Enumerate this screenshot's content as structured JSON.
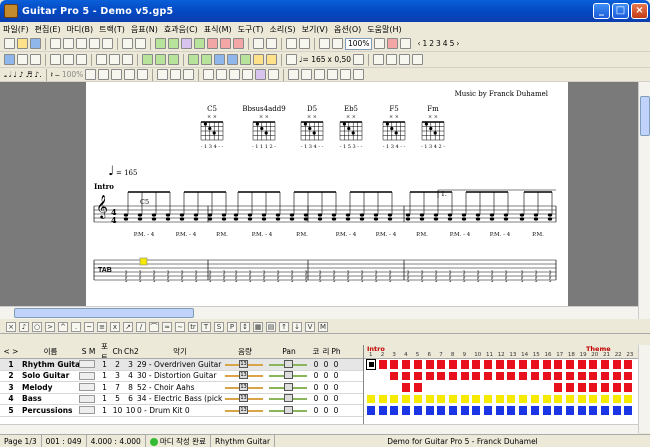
{
  "window": {
    "title": "Guitar Pro 5 - Demo v5.gp5"
  },
  "menu": [
    "파일(F)",
    "편집(E)",
    "마디(B)",
    "트랙(T)",
    "음표(N)",
    "효과음(C)",
    "표식(M)",
    "도구(T)",
    "소리(S)",
    "보기(V)",
    "옵션(O)",
    "도움말(H)"
  ],
  "toolbar": {
    "zoom": "100%",
    "pages": [
      "1",
      "2",
      "3",
      "4",
      "5"
    ],
    "tempo": "♩= 165",
    "speed": "x 0,50",
    "zoom_label": "100%"
  },
  "score": {
    "credit": "Music by Franck Duhamel",
    "chords": [
      {
        "name": "C5",
        "fingering": "- 1 3 4 - -"
      },
      {
        "name": "Bbsus4add9",
        "fingering": "- 1 1 1 2 -"
      },
      {
        "name": "D5",
        "fingering": "- 1 3 4 - -"
      },
      {
        "name": "Eb5",
        "fingering": "- 1 5 3 - -"
      },
      {
        "name": "F5",
        "fingering": "- 1 3 4 - -"
      },
      {
        "name": "Fm",
        "fingering": "- 1 3 4 2 -"
      }
    ],
    "tempo": "= 165",
    "section": "Intro",
    "chord_above": "C5",
    "volta": "1.",
    "pm_labels": [
      "P.M. - 4",
      "P.M. - 4",
      "P.M.",
      "P.M. - 4",
      "P.M.",
      "P.M. - 4",
      "P.M. - 4",
      "P.M.",
      "P.M. - 4",
      "P.M. - 4",
      "P.M."
    ],
    "tab_label": "TAB",
    "time_sig": [
      "4",
      "4"
    ]
  },
  "tracks": {
    "header": {
      "num": "< >",
      "name": "이름",
      "sm": "S M",
      "port": "포트",
      "ch": "Ch",
      "ch2": "Ch2",
      "instrument": "악기",
      "volume": "음량",
      "pan": "Pan",
      "c1": "코",
      "c2": "리",
      "ph": "Ph"
    },
    "rows": [
      {
        "num": "1",
        "name": "Rhythm Guitar",
        "port": "1",
        "ch": "2",
        "ch2": "3",
        "instrument": "29 - Overdriven Guitar",
        "vol": "13",
        "pan": "8",
        "c": "0",
        "r": "0",
        "ph": "0"
      },
      {
        "num": "2",
        "name": "Solo Guitar",
        "port": "1",
        "ch": "3",
        "ch2": "4",
        "instrument": "30 - Distortion Guitar",
        "vol": "13",
        "pan": "8",
        "c": "0",
        "r": "0",
        "ph": "0"
      },
      {
        "num": "3",
        "name": "Melody",
        "port": "1",
        "ch": "7",
        "ch2": "8",
        "instrument": "52 - Choir Aahs",
        "vol": "13",
        "pan": "8",
        "c": "0",
        "r": "0",
        "ph": "0"
      },
      {
        "num": "4",
        "name": "Bass",
        "port": "1",
        "ch": "5",
        "ch2": "6",
        "instrument": "34 - Electric Bass (pick)",
        "vol": "13",
        "pan": "8",
        "c": "0",
        "r": "0",
        "ph": "0"
      },
      {
        "num": "5",
        "name": "Percussions",
        "port": "1",
        "ch": "10",
        "ch2": "10",
        "instrument": "0 - Drum Kit 0",
        "vol": "13",
        "pan": "8",
        "c": "0",
        "r": "0",
        "ph": "0"
      }
    ],
    "sections": [
      {
        "label": "Intro"
      },
      {
        "label": "Theme"
      }
    ],
    "measures": [
      "1",
      "2",
      "3",
      "4",
      "5",
      "6",
      "7",
      "8",
      "9",
      "10",
      "11",
      "12",
      "13",
      "14",
      "15",
      "16",
      "17",
      "18",
      "19",
      "20",
      "21",
      "22",
      "23"
    ]
  },
  "colors": {
    "red": "#e8101c",
    "yellow": "#f6ea00",
    "blue": "#1a35e6",
    "sel": "#c00000"
  },
  "status": {
    "page": "Page 1/3",
    "bar": "001 : 049",
    "time": "4.000 : 4.000",
    "mode": "마디 작성 완료",
    "track": "Rhythm Guitar",
    "song": "Demo for Guitar Pro 5 - Franck Duhamel"
  }
}
